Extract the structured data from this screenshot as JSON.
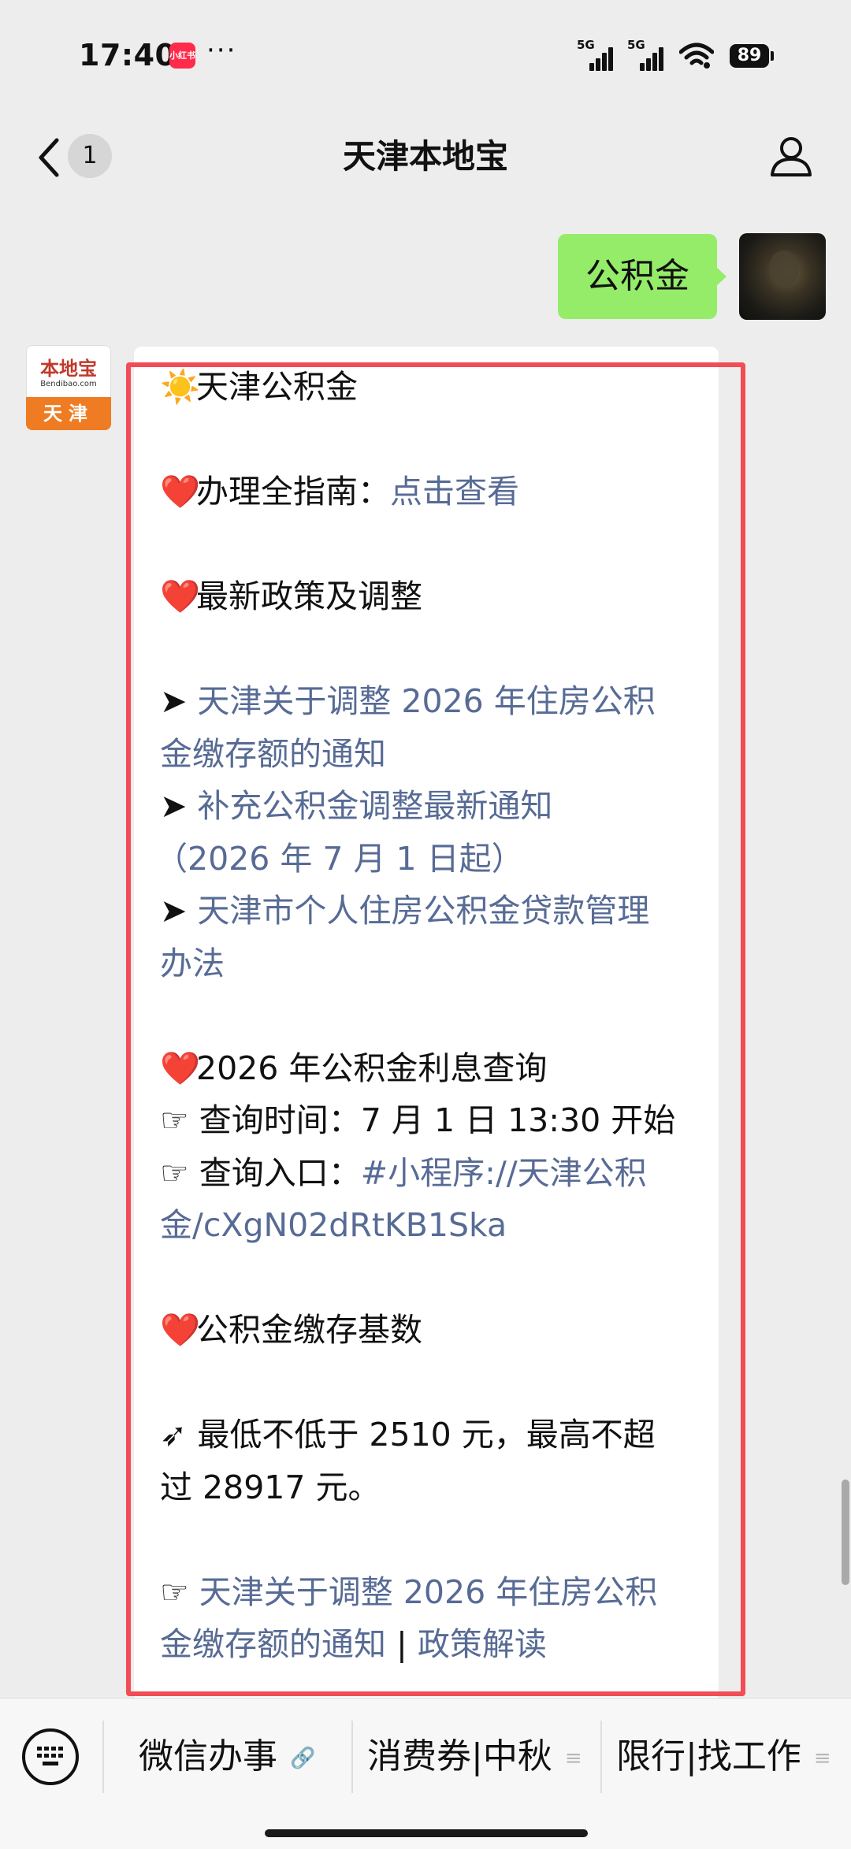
{
  "status_bar": {
    "time": "17:40",
    "app_badge": "小红书",
    "dots": "···",
    "signal1": "5G",
    "signal2": "5G",
    "battery": "89"
  },
  "nav": {
    "unread_count": "1",
    "title": "天津本地宝"
  },
  "sent_message": {
    "text": "公积金"
  },
  "sender_avatar": {
    "top_text": "本地宝",
    "url": "Bendibao.com",
    "city": "天津"
  },
  "message": {
    "title": "天津公积金",
    "guide_label": "办理全指南：",
    "guide_link": "点击查看",
    "policy_heading": "最新政策及调整",
    "link1_line1": "天津关于调整 2026 年住房公积",
    "link1_line2": "金缴存额的通知",
    "link2_line1": "补充公积金调整最新通知",
    "link2_line2": "（2026 年 7 月 1 日起）",
    "link3_line1": "天津市个人住房公积金贷款管理",
    "link3_line2": "办法",
    "interest_heading": "2026 年公积金利息查询",
    "query_time": "查询时间：7 月 1 日 13:30 开始",
    "entry_label": "查询入口：",
    "entry_link1": "#小程序://天津公积",
    "entry_link2": "金/cXgN02dRtKB1Ska",
    "base_heading": "公积金缴存基数",
    "base_line1": "最低不低于 2510 元，最高不超",
    "base_line2": "过 28917 元。",
    "link4_line1": "天津关于调整 2026 年住房公积",
    "link4_line2a": "金缴存额的通知",
    "separator": " | ",
    "link4_line2b": "政策解读"
  },
  "bottom_menu": {
    "item1": "微信办事",
    "item2": "消费券|中秋",
    "item3": "限行|找工作"
  },
  "colors": {
    "link": "#576b95",
    "sent_bubble": "#95ec69",
    "highlight": "#f24c56"
  }
}
